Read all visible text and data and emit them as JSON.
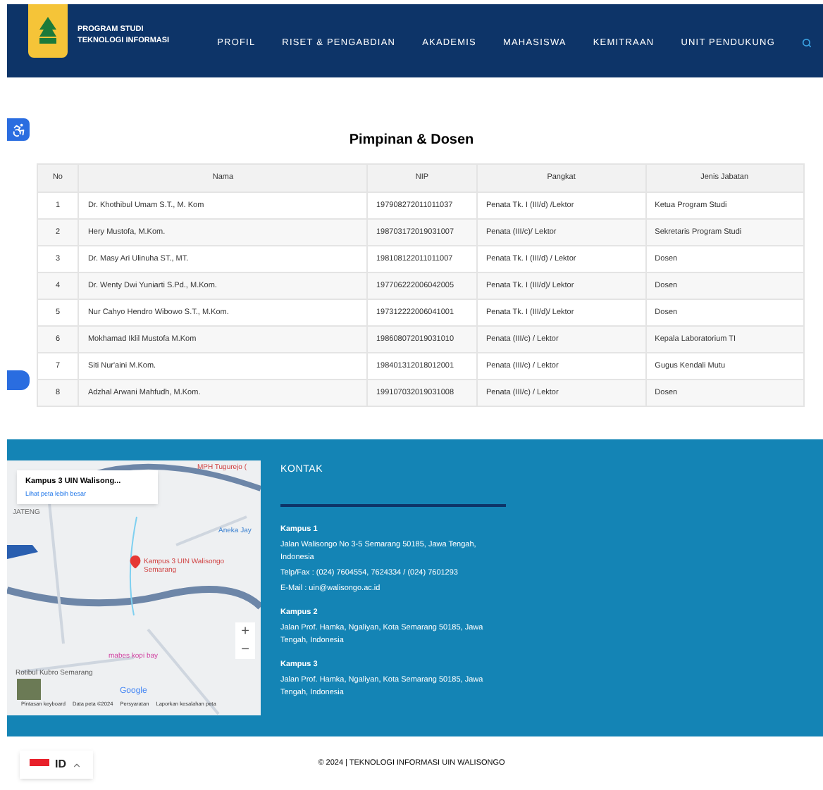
{
  "header": {
    "brand_line_1": "PROGRAM STUDI",
    "brand_line_2": "TEKNOLOGI INFORMASI",
    "nav": [
      "PROFIL",
      "RISET & PENGABDIAN",
      "AKADEMIS",
      "MAHASISWA",
      "KEMITRAAN",
      "UNIT PENDUKUNG"
    ]
  },
  "table": {
    "title": "Pimpinan & Dosen",
    "columns": [
      "No",
      "Nama",
      "NIP",
      "Pangkat",
      "Jenis Jabatan"
    ],
    "rows": [
      [
        "1",
        "Dr. Khothibul Umam S.T., M. Kom",
        "197908272011011037",
        "Penata Tk. I (III/d) /Lektor",
        "Ketua Program Studi"
      ],
      [
        "2",
        "Hery Mustofa, M.Kom.",
        "198703172019031007",
        "Penata (III/c)/ Lektor",
        "Sekretaris Program Studi"
      ],
      [
        "3",
        "Dr. Masy Ari Ulinuha ST., MT.",
        "198108122011011007",
        "Penata Tk. I (III/d) / Lektor",
        "Dosen"
      ],
      [
        "4",
        "Dr. Wenty Dwi Yuniarti S.Pd., M.Kom.",
        "197706222006042005",
        "Penata Tk. I (III/d)/ Lektor",
        "Dosen"
      ],
      [
        "5",
        "Nur Cahyo Hendro Wibowo S.T., M.Kom.",
        "197312222006041001",
        "Penata Tk. I (III/d)/ Lektor",
        "Dosen"
      ],
      [
        "6",
        "Mokhamad Iklil Mustofa M.Kom",
        "198608072019031010",
        "Penata (III/c) / Lektor",
        "Kepala Laboratorium TI"
      ],
      [
        "7",
        "Siti Nur'aini M.Kom.",
        "198401312018012001",
        "Penata (III/c) / Lektor",
        "Gugus Kendali Mutu"
      ],
      [
        "8",
        "Adzhal Arwani Mahfudh, M.Kom.",
        "199107032019031008",
        "Penata (III/c) / Lektor",
        "Dosen"
      ]
    ]
  },
  "map": {
    "card_title": "Kampus 3 UIN Walisong...",
    "card_link": "Lihat peta lebih besar",
    "labels": [
      "MPH Tugurejo (",
      "JATENG",
      "Aneka Jay",
      "Kampus 3 UIN Walisongo Semarang",
      "mabes kopi bay",
      "Rotibul Kubro Semarang"
    ],
    "zoom_in": "+",
    "zoom_out": "−",
    "google": "Google",
    "attribution": [
      "Pintasan keyboard",
      "Data peta ©2024",
      "Persyaratan",
      "Laporkan kesalahan peta"
    ]
  },
  "contact": {
    "heading": "KONTAK",
    "campuses": [
      {
        "name": "Kampus 1",
        "lines": [
          "Jalan Walisongo No 3-5 Semarang 50185, Jawa Tengah, Indonesia",
          "Telp/Fax : (024) 7604554, 7624334 / (024) 7601293",
          "E-Mail : uin@walisongo.ac.id"
        ]
      },
      {
        "name": "Kampus 2",
        "lines": [
          "Jalan Prof. Hamka, Ngaliyan, Kota Semarang 50185, Jawa Tengah, Indonesia"
        ]
      },
      {
        "name": "Kampus 3",
        "lines": [
          "Jalan Prof. Hamka, Ngaliyan, Kota Semarang 50185, Jawa Tengah, Indonesia"
        ]
      }
    ]
  },
  "copyright": "© 2024 | TEKNOLOGI INFORMASI UIN WALISONGO",
  "language": "ID"
}
